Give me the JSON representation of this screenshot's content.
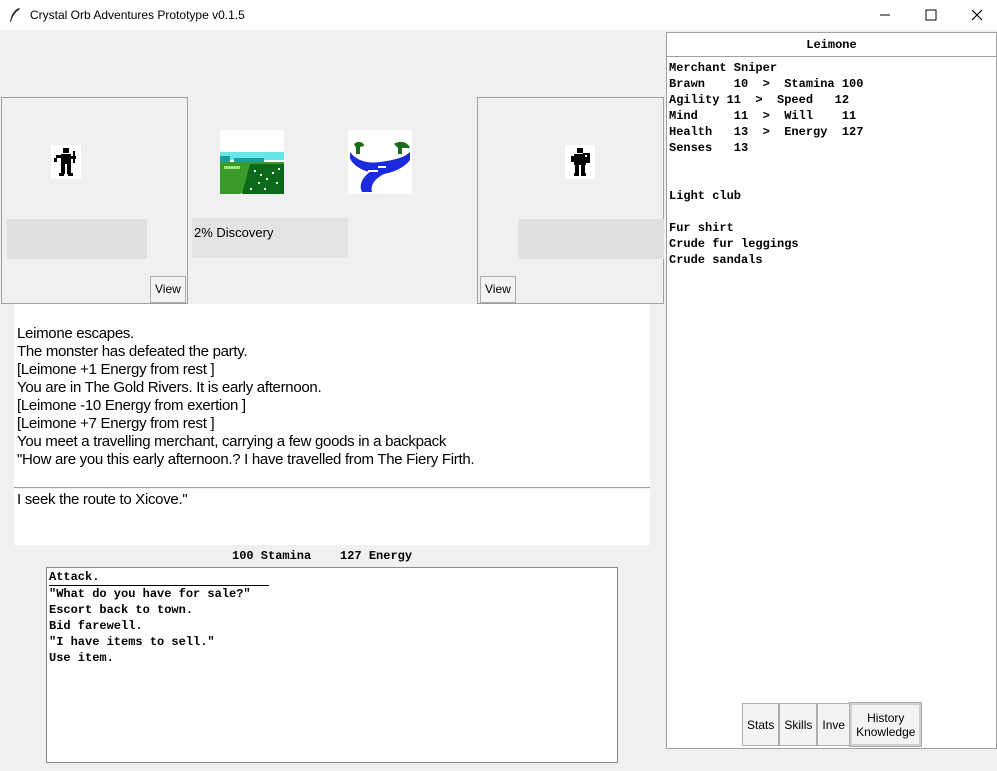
{
  "window": {
    "title": "Crystal Orb Adventures Prototype v0.1.5"
  },
  "party": {
    "left_view_label": "View",
    "right_view_label": "View",
    "discovery": "2% Discovery"
  },
  "log": {
    "lines": [
      "Leimone escapes.",
      "The monster has defeated the party.",
      "[Leimone +1 Energy from rest ]",
      "You are in The Gold Rivers. It is  early afternoon.",
      "[Leimone -10 Energy from exertion ]",
      "[Leimone +7 Energy from rest ]",
      "You meet a travelling merchant, carrying a few goods in a backpack",
      "\"How are you this early afternoon.? I have travelled from The Fiery Firth."
    ],
    "speech": "I seek the route to Xicove.\""
  },
  "status": {
    "stamina": "100 Stamina",
    "energy": "127 Energy"
  },
  "actions": [
    "Attack.",
    "\"What do you have for sale?\"",
    "Escort back to town.",
    "Bid farewell.",
    "\"I have items to sell.\"",
    "Use item."
  ],
  "sheet": {
    "name": "Leimone",
    "class": "Merchant Sniper",
    "stats": [
      "Brawn    10  >  Stamina 100",
      "Agility 11  >  Speed   12",
      "Mind     11  >  Will    11",
      "Health   13  >  Energy  127",
      "Senses   13"
    ],
    "weapon": "Light club",
    "armor": [
      "Fur shirt",
      "Crude fur leggings",
      "Crude sandals"
    ]
  },
  "tabs": {
    "stats": "Stats",
    "skills": "Skills",
    "inventory": "Inve",
    "history": "History",
    "knowledge": "Knowledge"
  }
}
